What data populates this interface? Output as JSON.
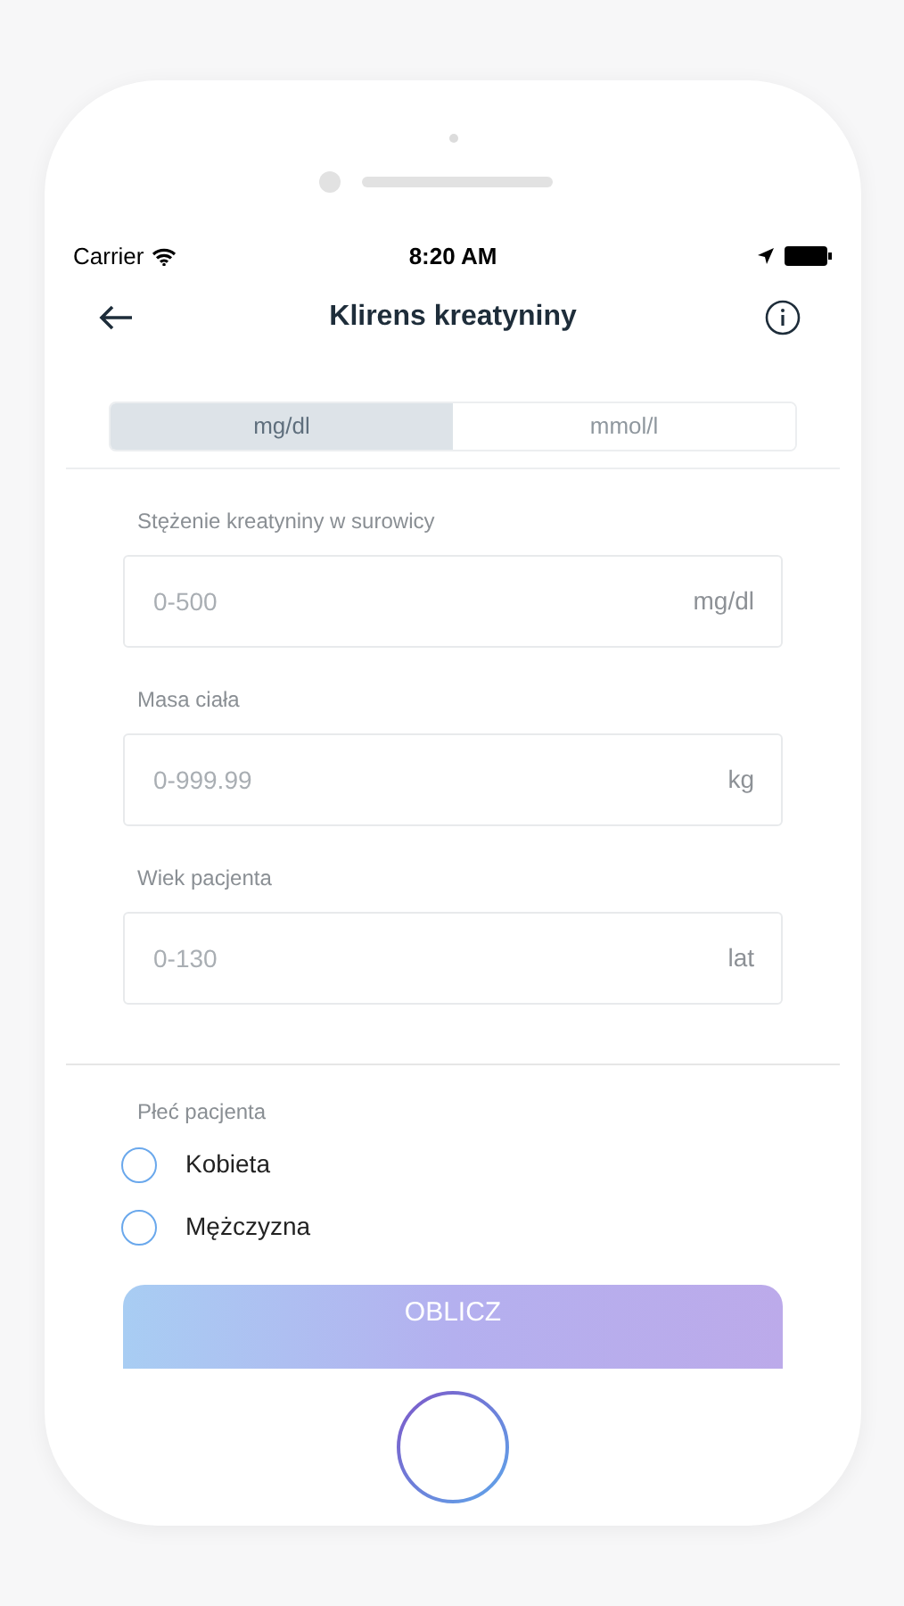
{
  "status_bar": {
    "carrier": "Carrier",
    "time": "8:20 AM"
  },
  "nav": {
    "title": "Klirens kreatyniny"
  },
  "unit_toggle": [
    {
      "label": "mg/dl",
      "selected": true
    },
    {
      "label": "mmol/l",
      "selected": false
    }
  ],
  "fields": [
    {
      "label": "Stężenie kreatyniny w surowicy",
      "placeholder": "0-500",
      "unit": "mg/dl"
    },
    {
      "label": "Masa ciała",
      "placeholder": "0-999.99",
      "unit": "kg"
    },
    {
      "label": "Wiek pacjenta",
      "placeholder": "0-130",
      "unit": "lat"
    }
  ],
  "gender": {
    "label": "Płeć pacjenta",
    "options": [
      {
        "label": "Kobieta",
        "selected": false
      },
      {
        "label": "Mężczyzna",
        "selected": false
      }
    ]
  },
  "button": {
    "label": "OBLICZ"
  }
}
